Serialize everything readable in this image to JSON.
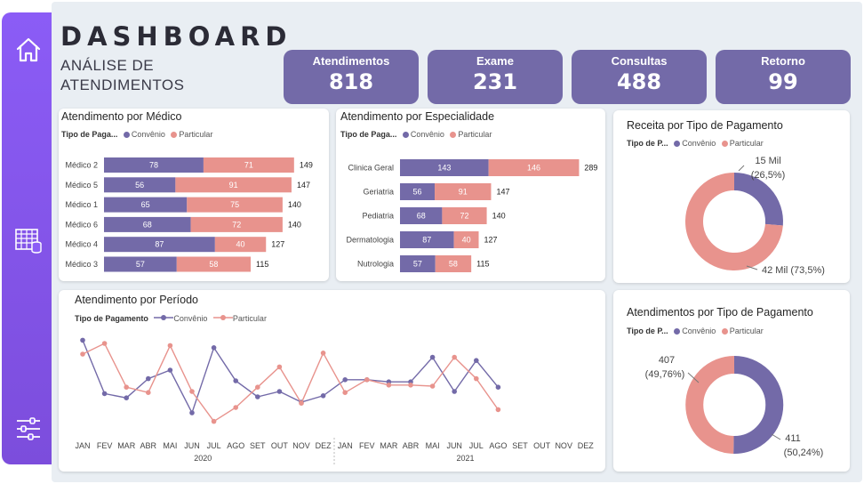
{
  "header": {
    "title": "DASHBOARD",
    "subtitle_line1": "ANÁLISE DE",
    "subtitle_line2": "ATENDIMENTOS"
  },
  "sidebar": {
    "icons": [
      "home-icon",
      "table-icon",
      "filter-settings-icon"
    ]
  },
  "kpis": [
    {
      "label": "Atendimentos",
      "value": "818"
    },
    {
      "label": "Exame",
      "value": "231"
    },
    {
      "label": "Consultas",
      "value": "488"
    },
    {
      "label": "Retorno",
      "value": "99"
    }
  ],
  "legend": {
    "label_full": "Tipo de Pagamento",
    "label_a": "Tipo de Paga...",
    "label_b": "Tipo de P...",
    "s1": "Convênio",
    "s2": "Particular"
  },
  "colors": {
    "convenio": "#736aa8",
    "particular": "#e8938d",
    "sidebar": "#8b5cf6",
    "kpi": "#736aa8"
  },
  "chart_data": [
    {
      "type": "bar",
      "orientation": "horizontal",
      "stacked": true,
      "title": "Atendimento por Médico",
      "categories": [
        "Médico 2",
        "Médico 5",
        "Médico 1",
        "Médico 6",
        "Médico 4",
        "Médico 3"
      ],
      "series": [
        {
          "name": "Convênio",
          "values": [
            78,
            56,
            65,
            68,
            87,
            57
          ]
        },
        {
          "name": "Particular",
          "values": [
            71,
            91,
            75,
            72,
            40,
            58
          ]
        }
      ],
      "totals": [
        149,
        147,
        140,
        140,
        127,
        115
      ]
    },
    {
      "type": "bar",
      "orientation": "horizontal",
      "stacked": true,
      "title": "Atendimento por Especialidade",
      "categories": [
        "Clinica Geral",
        "Geriatria",
        "Pediatria",
        "Dermatologia",
        "Nutrologia"
      ],
      "series": [
        {
          "name": "Convênio",
          "values": [
            143,
            56,
            68,
            87,
            57
          ]
        },
        {
          "name": "Particular",
          "values": [
            146,
            91,
            72,
            40,
            58
          ]
        }
      ],
      "totals": [
        289,
        147,
        140,
        127,
        115
      ]
    },
    {
      "type": "line",
      "title": "Atendimento por Período",
      "x": [
        "JAN",
        "FEV",
        "MAR",
        "ABR",
        "MAI",
        "JUN",
        "JUL",
        "AGO",
        "SET",
        "OUT",
        "NOV",
        "DEZ",
        "JAN",
        "FEV",
        "MAR",
        "ABR",
        "MAI",
        "JUN",
        "JUL",
        "AGO",
        "SET",
        "OUT",
        "NOV",
        "DEZ"
      ],
      "years": [
        "2020",
        "2021"
      ],
      "ylim": [
        0,
        100
      ],
      "series": [
        {
          "name": "Convênio",
          "values": [
            88,
            38,
            34,
            52,
            60,
            20,
            81,
            50,
            35,
            40,
            30,
            36,
            51,
            51,
            49,
            49,
            72,
            40,
            69,
            44
          ]
        },
        {
          "name": "Particular",
          "values": [
            75,
            85,
            44,
            39,
            83,
            40,
            12,
            25,
            44,
            63,
            29,
            76,
            39,
            51,
            46,
            46,
            45,
            72,
            52,
            23
          ]
        }
      ]
    },
    {
      "type": "pie",
      "donut": true,
      "title": "Receita por Tipo de Pagamento",
      "series": [
        {
          "name": "Convênio",
          "value": 15,
          "label": "15 Mil",
          "pct": "(26,5%)"
        },
        {
          "name": "Particular",
          "value": 42,
          "label": "42 Mil (73,5%)"
        }
      ]
    },
    {
      "type": "pie",
      "donut": true,
      "title": "Atendimentos por Tipo de Pagamento",
      "series": [
        {
          "name": "Convênio",
          "value": 411,
          "label": "411",
          "pct": "(50,24%)"
        },
        {
          "name": "Particular",
          "value": 407,
          "label": "407",
          "pct": "(49,76%)"
        }
      ]
    }
  ]
}
